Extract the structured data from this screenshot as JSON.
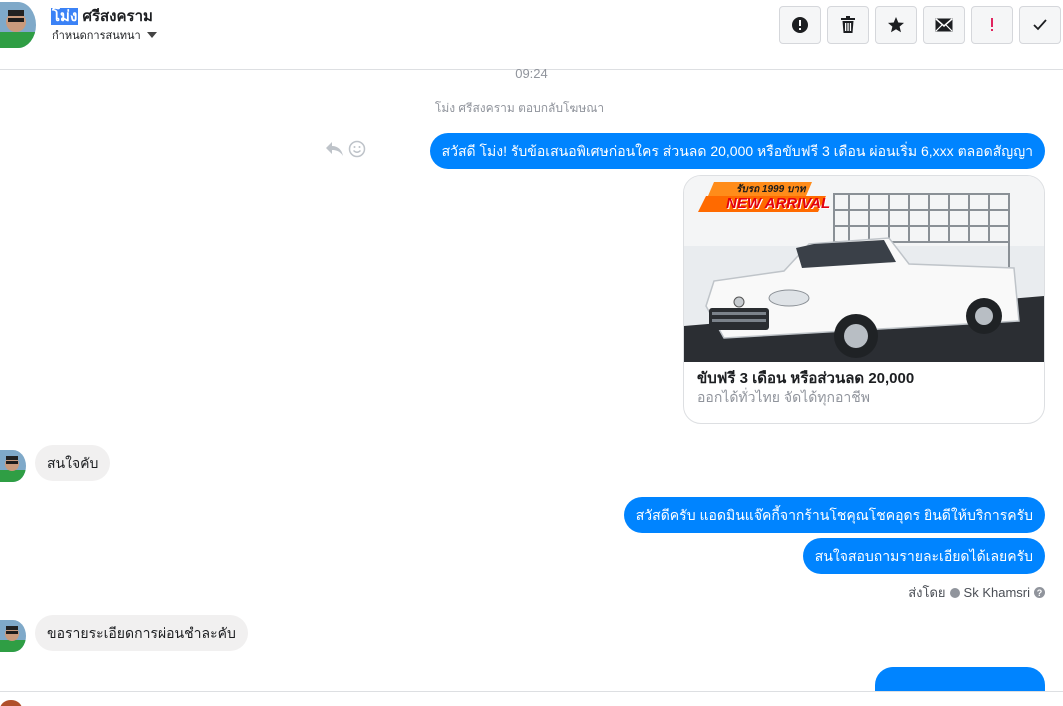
{
  "header": {
    "name_highlight": "โม่ง",
    "name_rest": " ศรีสงคราม",
    "subtitle": "กำหนดการสนทนา",
    "actions": [
      "alert-circle-icon",
      "trash-icon",
      "star-icon",
      "envelope-icon",
      "exclamation-icon",
      "check-icon"
    ]
  },
  "conversation": {
    "time": "09:24",
    "system_note": "โม่ง ศรีสงคราม ตอบกลับโฆษณา",
    "messages": [
      {
        "text": "สวัสดี โม่ง! รับข้อเสนอพิเศษก่อนใคร ส่วนลด 20,000 หรือขับฟรี 3 เดือน ผ่อนเริ่ม 6,xxx ตลอดสัญญา"
      },
      {
        "text": "สนใจคับ"
      },
      {
        "text": "สวัสดีครับ แอดมินแจ๊คกี้จากร้านโชคุณโชคอุดร ยินดีให้บริการครับ"
      },
      {
        "text": "สนใจสอบถามรายละเอียดได้เลยครับ"
      },
      {
        "text": "ขอรายระเอียดการผ่อนชำละคับ"
      }
    ],
    "card": {
      "banner_top": "รับรถ 1999 บาท",
      "banner_main": "NEW ARRIVAL",
      "title": "ขับฟรี 3 เดือน หรือส่วนลด 20,000",
      "subtitle": "ออกได้ทั่วไทย จัดได้ทุกอาชีพ"
    },
    "sent_by_label": "ส่งโดย",
    "sent_by_name": "Sk Khamsri",
    "help_glyph": "?"
  },
  "colors": {
    "outgoing": "#0084ff",
    "incoming": "#f1f0f0",
    "muted": "#90949c"
  }
}
